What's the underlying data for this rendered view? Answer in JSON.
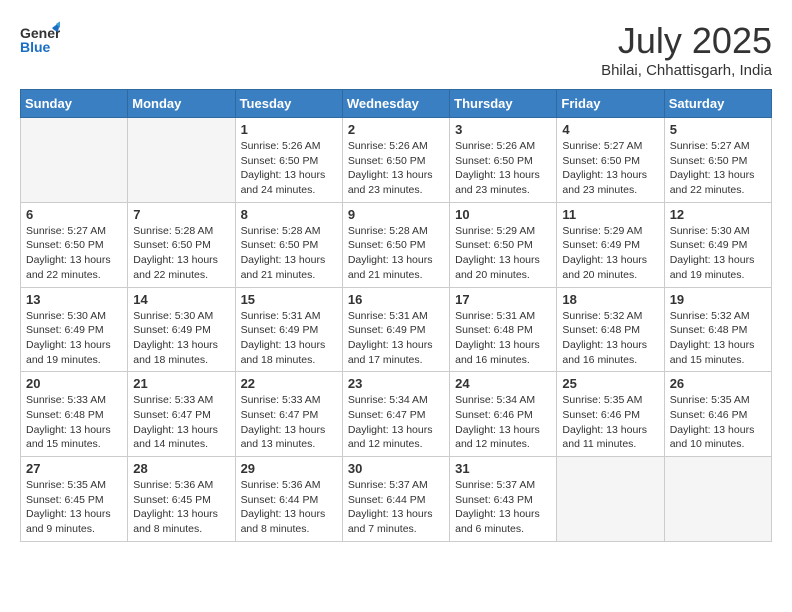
{
  "header": {
    "logo_line1": "General",
    "logo_line2": "Blue",
    "month": "July 2025",
    "location": "Bhilai, Chhattisgarh, India"
  },
  "days_of_week": [
    "Sunday",
    "Monday",
    "Tuesday",
    "Wednesday",
    "Thursday",
    "Friday",
    "Saturday"
  ],
  "weeks": [
    [
      {
        "day": "",
        "sunrise": "",
        "sunset": "",
        "daylight": ""
      },
      {
        "day": "",
        "sunrise": "",
        "sunset": "",
        "daylight": ""
      },
      {
        "day": "1",
        "sunrise": "Sunrise: 5:26 AM",
        "sunset": "Sunset: 6:50 PM",
        "daylight": "Daylight: 13 hours and 24 minutes."
      },
      {
        "day": "2",
        "sunrise": "Sunrise: 5:26 AM",
        "sunset": "Sunset: 6:50 PM",
        "daylight": "Daylight: 13 hours and 23 minutes."
      },
      {
        "day": "3",
        "sunrise": "Sunrise: 5:26 AM",
        "sunset": "Sunset: 6:50 PM",
        "daylight": "Daylight: 13 hours and 23 minutes."
      },
      {
        "day": "4",
        "sunrise": "Sunrise: 5:27 AM",
        "sunset": "Sunset: 6:50 PM",
        "daylight": "Daylight: 13 hours and 23 minutes."
      },
      {
        "day": "5",
        "sunrise": "Sunrise: 5:27 AM",
        "sunset": "Sunset: 6:50 PM",
        "daylight": "Daylight: 13 hours and 22 minutes."
      }
    ],
    [
      {
        "day": "6",
        "sunrise": "Sunrise: 5:27 AM",
        "sunset": "Sunset: 6:50 PM",
        "daylight": "Daylight: 13 hours and 22 minutes."
      },
      {
        "day": "7",
        "sunrise": "Sunrise: 5:28 AM",
        "sunset": "Sunset: 6:50 PM",
        "daylight": "Daylight: 13 hours and 22 minutes."
      },
      {
        "day": "8",
        "sunrise": "Sunrise: 5:28 AM",
        "sunset": "Sunset: 6:50 PM",
        "daylight": "Daylight: 13 hours and 21 minutes."
      },
      {
        "day": "9",
        "sunrise": "Sunrise: 5:28 AM",
        "sunset": "Sunset: 6:50 PM",
        "daylight": "Daylight: 13 hours and 21 minutes."
      },
      {
        "day": "10",
        "sunrise": "Sunrise: 5:29 AM",
        "sunset": "Sunset: 6:50 PM",
        "daylight": "Daylight: 13 hours and 20 minutes."
      },
      {
        "day": "11",
        "sunrise": "Sunrise: 5:29 AM",
        "sunset": "Sunset: 6:49 PM",
        "daylight": "Daylight: 13 hours and 20 minutes."
      },
      {
        "day": "12",
        "sunrise": "Sunrise: 5:30 AM",
        "sunset": "Sunset: 6:49 PM",
        "daylight": "Daylight: 13 hours and 19 minutes."
      }
    ],
    [
      {
        "day": "13",
        "sunrise": "Sunrise: 5:30 AM",
        "sunset": "Sunset: 6:49 PM",
        "daylight": "Daylight: 13 hours and 19 minutes."
      },
      {
        "day": "14",
        "sunrise": "Sunrise: 5:30 AM",
        "sunset": "Sunset: 6:49 PM",
        "daylight": "Daylight: 13 hours and 18 minutes."
      },
      {
        "day": "15",
        "sunrise": "Sunrise: 5:31 AM",
        "sunset": "Sunset: 6:49 PM",
        "daylight": "Daylight: 13 hours and 18 minutes."
      },
      {
        "day": "16",
        "sunrise": "Sunrise: 5:31 AM",
        "sunset": "Sunset: 6:49 PM",
        "daylight": "Daylight: 13 hours and 17 minutes."
      },
      {
        "day": "17",
        "sunrise": "Sunrise: 5:31 AM",
        "sunset": "Sunset: 6:48 PM",
        "daylight": "Daylight: 13 hours and 16 minutes."
      },
      {
        "day": "18",
        "sunrise": "Sunrise: 5:32 AM",
        "sunset": "Sunset: 6:48 PM",
        "daylight": "Daylight: 13 hours and 16 minutes."
      },
      {
        "day": "19",
        "sunrise": "Sunrise: 5:32 AM",
        "sunset": "Sunset: 6:48 PM",
        "daylight": "Daylight: 13 hours and 15 minutes."
      }
    ],
    [
      {
        "day": "20",
        "sunrise": "Sunrise: 5:33 AM",
        "sunset": "Sunset: 6:48 PM",
        "daylight": "Daylight: 13 hours and 15 minutes."
      },
      {
        "day": "21",
        "sunrise": "Sunrise: 5:33 AM",
        "sunset": "Sunset: 6:47 PM",
        "daylight": "Daylight: 13 hours and 14 minutes."
      },
      {
        "day": "22",
        "sunrise": "Sunrise: 5:33 AM",
        "sunset": "Sunset: 6:47 PM",
        "daylight": "Daylight: 13 hours and 13 minutes."
      },
      {
        "day": "23",
        "sunrise": "Sunrise: 5:34 AM",
        "sunset": "Sunset: 6:47 PM",
        "daylight": "Daylight: 13 hours and 12 minutes."
      },
      {
        "day": "24",
        "sunrise": "Sunrise: 5:34 AM",
        "sunset": "Sunset: 6:46 PM",
        "daylight": "Daylight: 13 hours and 12 minutes."
      },
      {
        "day": "25",
        "sunrise": "Sunrise: 5:35 AM",
        "sunset": "Sunset: 6:46 PM",
        "daylight": "Daylight: 13 hours and 11 minutes."
      },
      {
        "day": "26",
        "sunrise": "Sunrise: 5:35 AM",
        "sunset": "Sunset: 6:46 PM",
        "daylight": "Daylight: 13 hours and 10 minutes."
      }
    ],
    [
      {
        "day": "27",
        "sunrise": "Sunrise: 5:35 AM",
        "sunset": "Sunset: 6:45 PM",
        "daylight": "Daylight: 13 hours and 9 minutes."
      },
      {
        "day": "28",
        "sunrise": "Sunrise: 5:36 AM",
        "sunset": "Sunset: 6:45 PM",
        "daylight": "Daylight: 13 hours and 8 minutes."
      },
      {
        "day": "29",
        "sunrise": "Sunrise: 5:36 AM",
        "sunset": "Sunset: 6:44 PM",
        "daylight": "Daylight: 13 hours and 8 minutes."
      },
      {
        "day": "30",
        "sunrise": "Sunrise: 5:37 AM",
        "sunset": "Sunset: 6:44 PM",
        "daylight": "Daylight: 13 hours and 7 minutes."
      },
      {
        "day": "31",
        "sunrise": "Sunrise: 5:37 AM",
        "sunset": "Sunset: 6:43 PM",
        "daylight": "Daylight: 13 hours and 6 minutes."
      },
      {
        "day": "",
        "sunrise": "",
        "sunset": "",
        "daylight": ""
      },
      {
        "day": "",
        "sunrise": "",
        "sunset": "",
        "daylight": ""
      }
    ]
  ]
}
